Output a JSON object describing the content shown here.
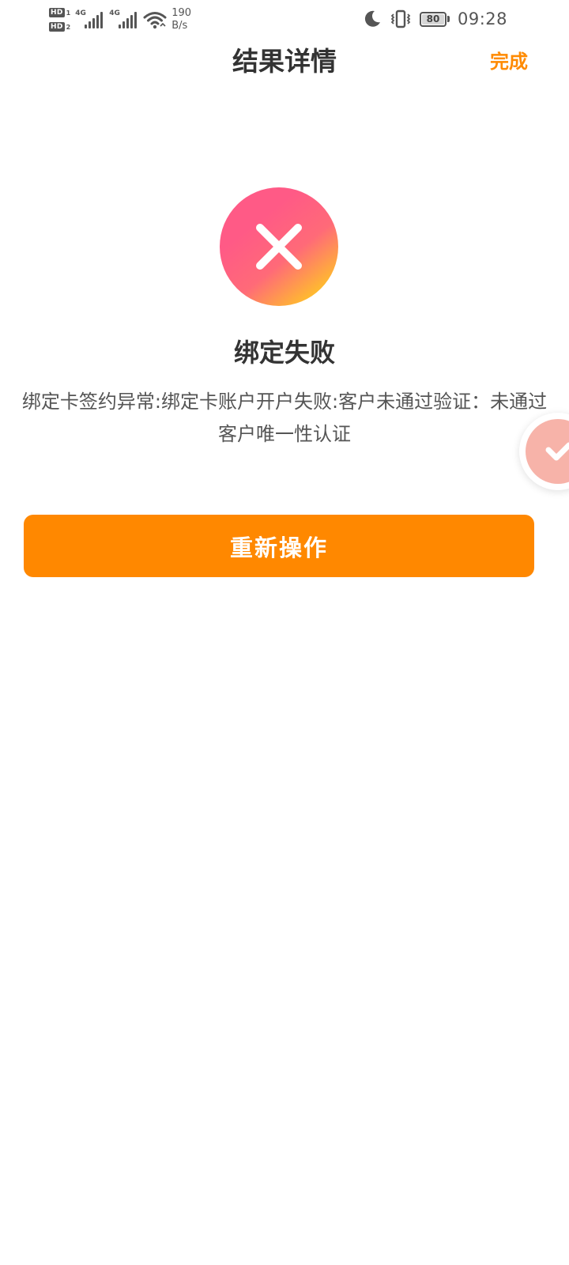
{
  "status_bar": {
    "sim1_badge": "HD",
    "sim1_index": "1",
    "sim2_badge": "HD",
    "sim2_index": "2",
    "network_1": "4G",
    "network_2": "4G",
    "net_speed_value": "190",
    "net_speed_unit": "B/s",
    "battery_level": "80",
    "time": "09:28",
    "icons": [
      "signal-icon",
      "wifi-icon",
      "moon-icon",
      "vibrate-icon",
      "battery-icon"
    ]
  },
  "header": {
    "title": "结果详情",
    "done_label": "完成"
  },
  "result": {
    "status_icon": "error-x-icon",
    "title": "绑定失败",
    "message": "绑定卡签约异常:绑定卡账户开户失败:客户未通过验证：未通过客户唯一性认证"
  },
  "actions": {
    "retry_label": "重新操作"
  },
  "floating_widget": {
    "icon": "check-icon"
  },
  "colors": {
    "accent": "#ff8800",
    "done_text": "#ff8a00",
    "error_gradient_start": "#ff5a86",
    "error_gradient_end": "#ffd21a",
    "title_text": "#333333",
    "body_text": "#555555"
  }
}
